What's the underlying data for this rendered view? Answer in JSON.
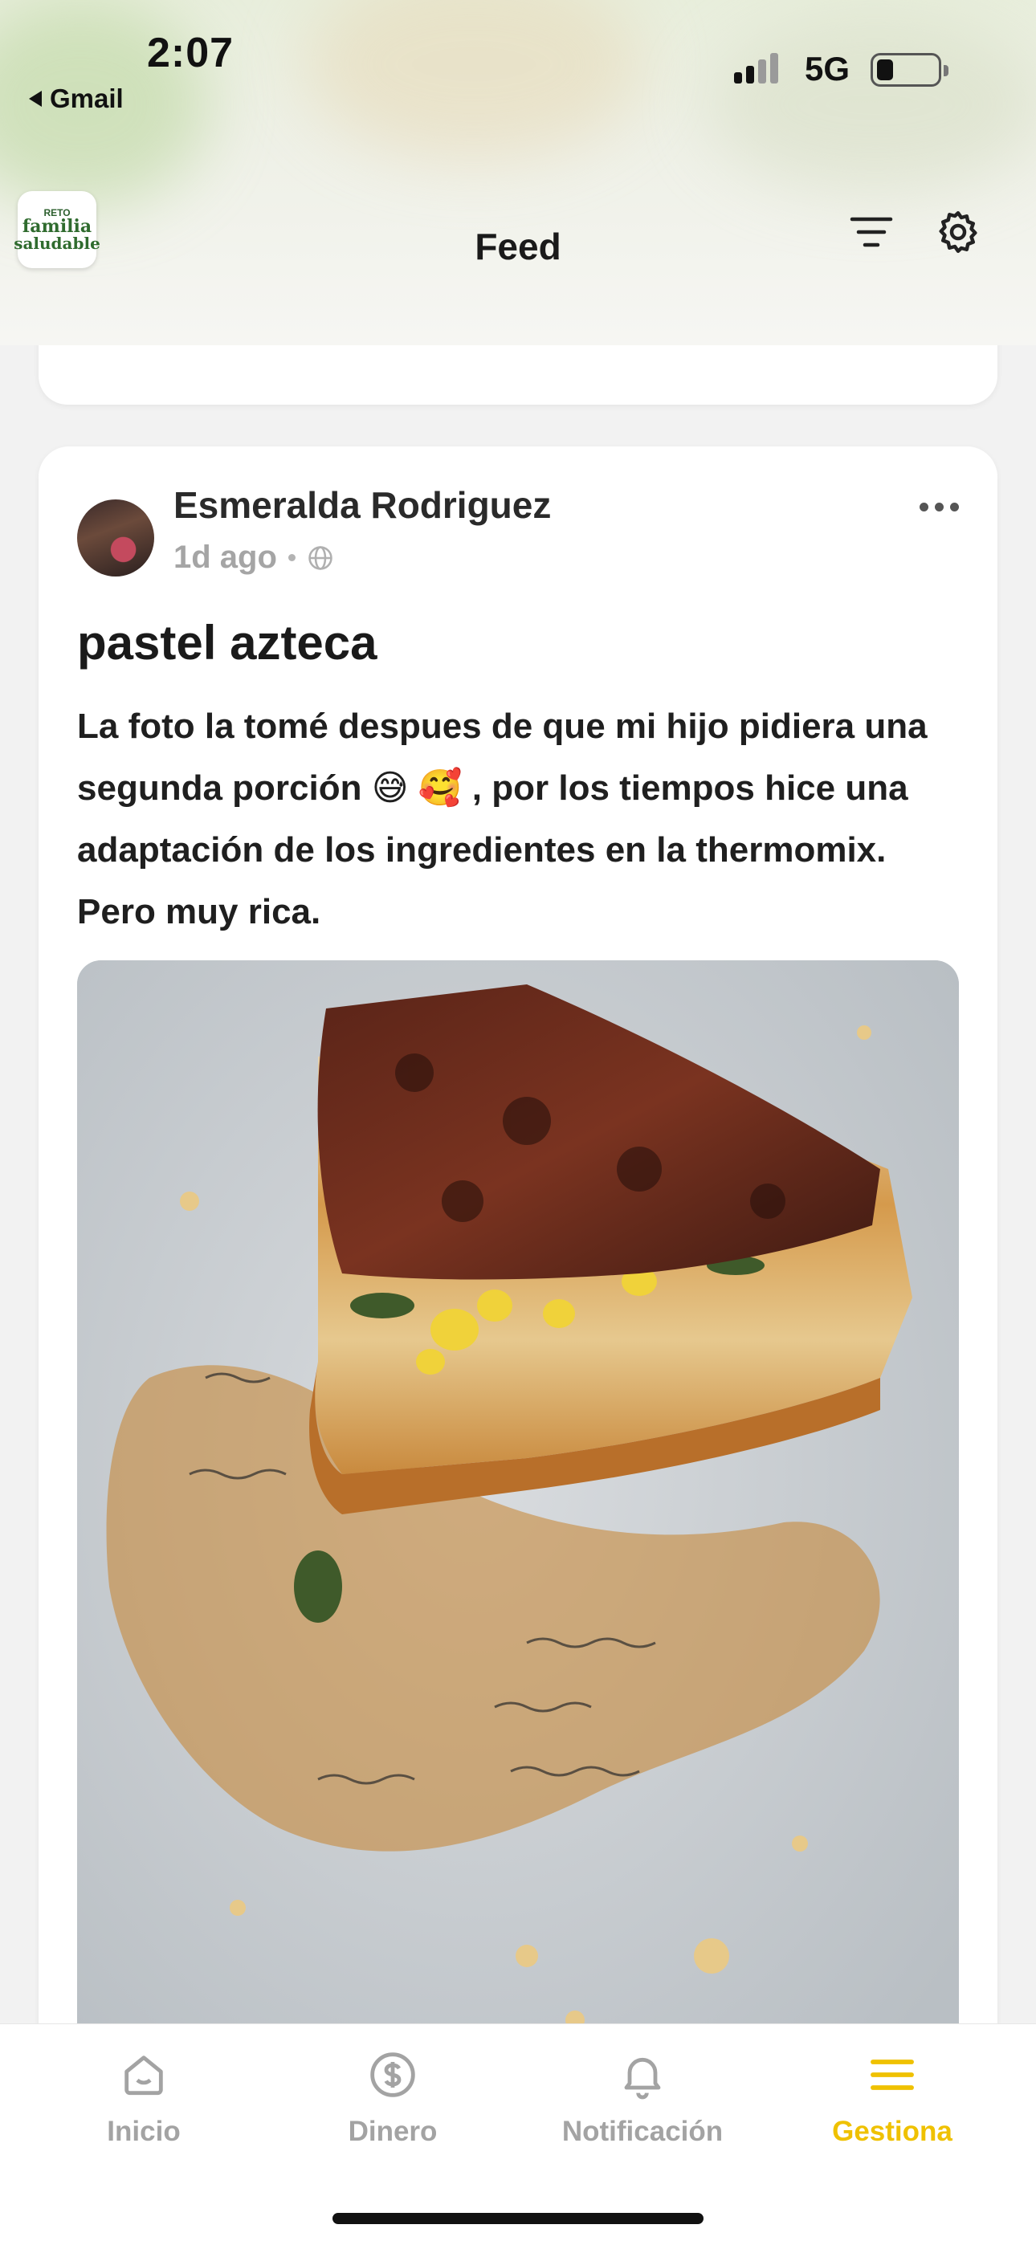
{
  "status_bar": {
    "time": "2:07",
    "back_app": "Gmail",
    "network": "5G"
  },
  "header": {
    "logo_text": {
      "line1": "RETO",
      "line2": "familia",
      "line3": "saludable"
    },
    "title": "Feed",
    "filter_icon": "filter-icon",
    "settings_icon": "gear-icon"
  },
  "post": {
    "author": "Esmeralda Rodriguez",
    "time_ago": "1d ago",
    "visibility_icon": "globe-icon",
    "title": "pastel azteca",
    "body": "La foto la tomé despues de que mi hijo pidiera una segunda porción 😅 🥰 , por los tiempos hice una adaptación de los ingredientes en la thermomix. Pero muy rica.",
    "image_icon": "food-photo"
  },
  "bottom_nav": {
    "items": [
      {
        "label": "Inicio",
        "icon": "home-icon",
        "active": false
      },
      {
        "label": "Dinero",
        "icon": "dollar-icon",
        "active": false
      },
      {
        "label": "Notificación",
        "icon": "bell-icon",
        "active": false
      },
      {
        "label": "Gestiona",
        "icon": "menu-icon",
        "active": true
      }
    ]
  },
  "colors": {
    "accent": "#efc100",
    "inactive": "#a3a3a3",
    "background": "#f2f2f2"
  }
}
